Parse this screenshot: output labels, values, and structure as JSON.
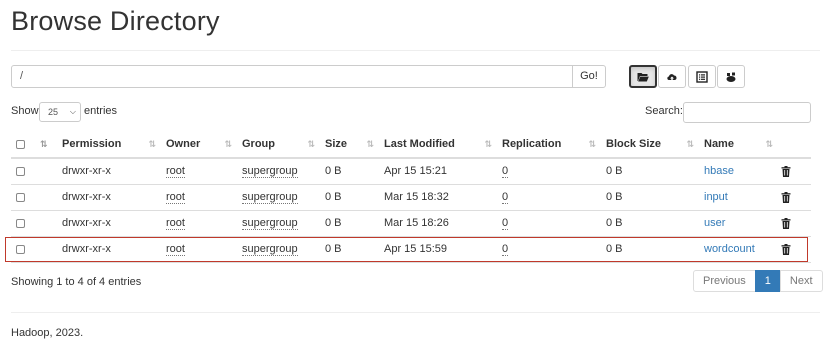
{
  "page": {
    "title": "Browse Directory",
    "footer": "Hadoop, 2023."
  },
  "path_bar": {
    "value": "/",
    "go_label": "Go!"
  },
  "toolbar": {
    "icons": [
      "folder-open-icon",
      "cloud-upload-icon",
      "list-alt-icon",
      "cut-paste-icon"
    ],
    "active_index": 0
  },
  "controls": {
    "show_label": "Show",
    "page_length": "25",
    "entries_label": "entries",
    "search_label": "Search:",
    "search_value": ""
  },
  "table": {
    "headers": [
      "Permission",
      "Owner",
      "Group",
      "Size",
      "Last Modified",
      "Replication",
      "Block Size",
      "Name"
    ],
    "rows": [
      {
        "permission": "drwxr-xr-x",
        "owner": "root",
        "group": "supergroup",
        "size": "0 B",
        "modified": "Apr 15 15:21",
        "replication": "0",
        "block_size": "0 B",
        "name": "hbase"
      },
      {
        "permission": "drwxr-xr-x",
        "owner": "root",
        "group": "supergroup",
        "size": "0 B",
        "modified": "Mar 15 18:32",
        "replication": "0",
        "block_size": "0 B",
        "name": "input"
      },
      {
        "permission": "drwxr-xr-x",
        "owner": "root",
        "group": "supergroup",
        "size": "0 B",
        "modified": "Mar 15 18:26",
        "replication": "0",
        "block_size": "0 B",
        "name": "user"
      },
      {
        "permission": "drwxr-xr-x",
        "owner": "root",
        "group": "supergroup",
        "size": "0 B",
        "modified": "Apr 15 15:59",
        "replication": "0",
        "block_size": "0 B",
        "name": "wordcount"
      }
    ],
    "highlighted_row": 3
  },
  "pagination": {
    "info": "Showing 1 to 4 of 4 entries",
    "previous": "Previous",
    "current": "1",
    "next": "Next"
  },
  "colors": {
    "accent": "#337ab7",
    "highlight": "#c0392b"
  }
}
